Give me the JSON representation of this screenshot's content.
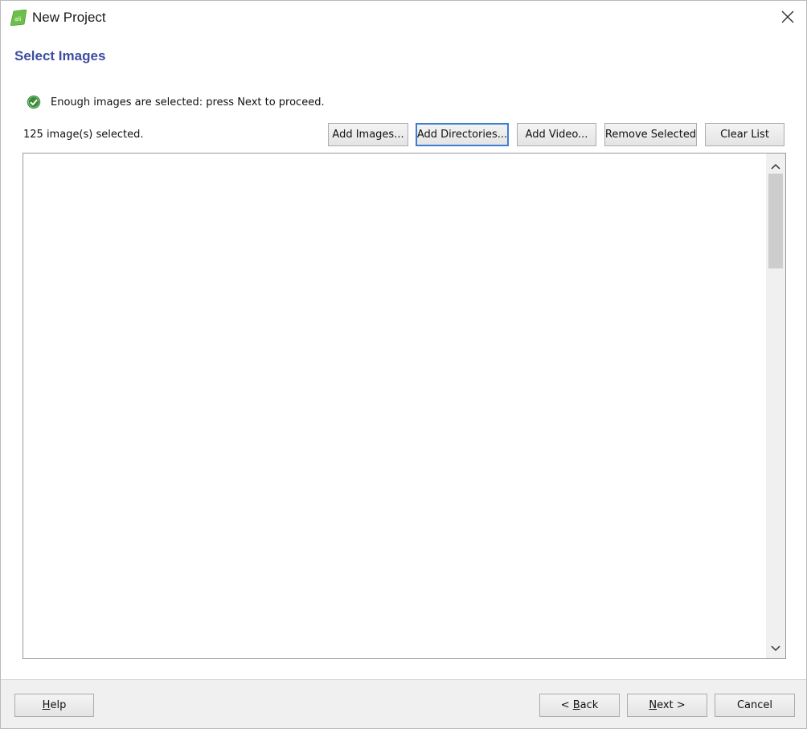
{
  "window": {
    "title": "New Project",
    "close_icon": "close-icon",
    "app_icon": "app-logo-icon"
  },
  "page": {
    "title": "Select Images"
  },
  "status": {
    "icon": "check-circle-icon",
    "message": "Enough images are selected: press Next to proceed.",
    "count": "125 image(s) selected."
  },
  "toolbar": {
    "add_images": "Add Images...",
    "add_directories": "Add Directories...",
    "add_video": "Add Video...",
    "remove_selected": "Remove Selected",
    "clear_list": "Clear List"
  },
  "footer": {
    "help_mnemonic": "H",
    "help_rest": "elp",
    "back_prefix": "< ",
    "back_mnemonic": "B",
    "back_rest": "ack",
    "next_mnemonic": "N",
    "next_rest": "ext >",
    "cancel": "Cancel"
  },
  "colors": {
    "accent_title": "#3b4da0",
    "status_ok": "#3a8a3a",
    "focus_border": "#3c7fd1"
  }
}
